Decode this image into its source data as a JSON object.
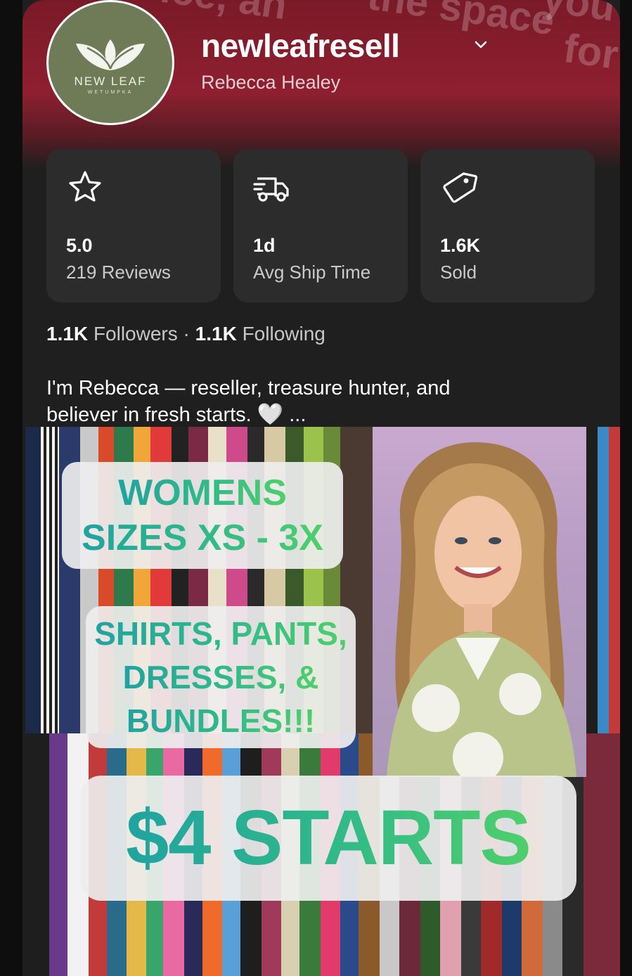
{
  "profile": {
    "username": "newleafresell",
    "display_name": "Rebecca Healey",
    "logo": {
      "name": "NEW LEAF",
      "location": "WETUMPKA"
    },
    "banner_text": [
      "ice, an",
      "the space",
      "you",
      "for"
    ]
  },
  "stats": [
    {
      "icon": "star-icon",
      "value": "5.0",
      "label": "219 Reviews"
    },
    {
      "icon": "truck-icon",
      "value": "1d",
      "label": "Avg Ship Time"
    },
    {
      "icon": "tag-icon",
      "value": "1.6K",
      "label": "Sold"
    }
  ],
  "social": {
    "followers_count": "1.1K",
    "followers_label": "Followers",
    "separator": "·",
    "following_count": "1.1K",
    "following_label": "Following"
  },
  "bio": {
    "line1": "I'm Rebecca — reseller, treasure hunter, and",
    "line2": "believer in fresh starts.",
    "heart": "🤍",
    "more": "..."
  },
  "promo": {
    "line1": "WOMENS",
    "line2": "SIZES XS - 3X",
    "line3": "SHIRTS, PANTS,",
    "line4": "DRESSES, &",
    "line5": "BUNDLES!!!",
    "price": "$4 STARTS"
  },
  "colors": {
    "banner": "#8e1f30",
    "card": "#2c2c2c",
    "background": "#1f1f1f",
    "logo_green": "#6f7a56",
    "promo_gradient_start": "#20a3a0",
    "promo_gradient_end": "#4fcf6b"
  }
}
